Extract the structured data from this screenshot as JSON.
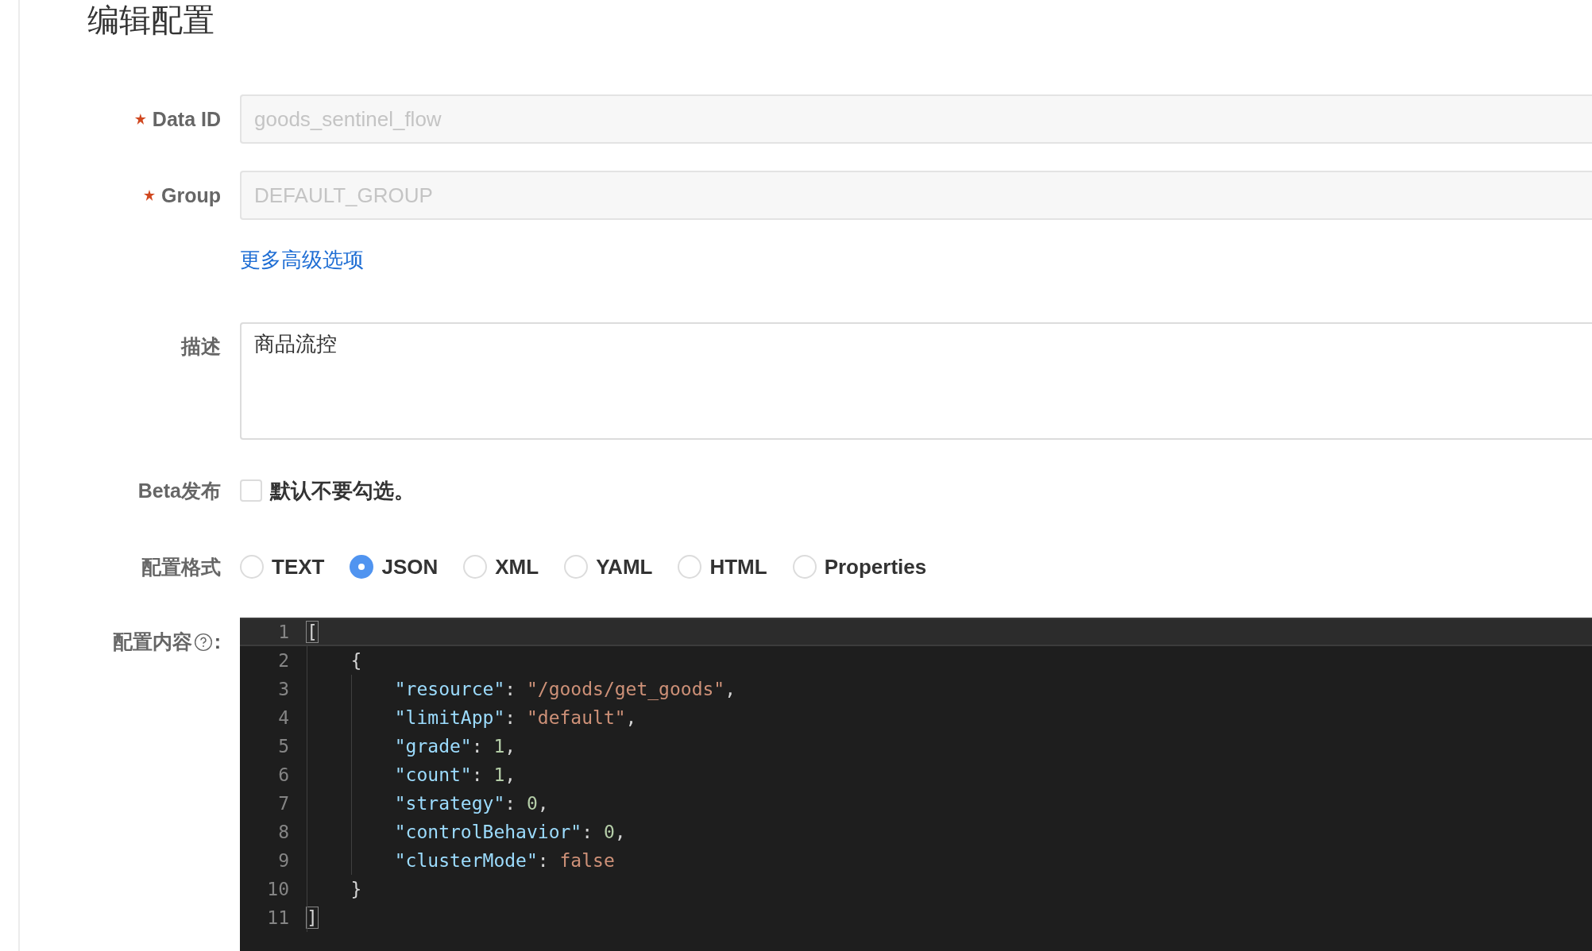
{
  "title": "编辑配置",
  "fields": [
    {
      "label": "Data ID",
      "required": true,
      "placeholder": "goods_sentinel_flow"
    },
    {
      "label": "Group",
      "required": true,
      "placeholder": "DEFAULT_GROUP"
    }
  ],
  "advanced_link": "更多高级选项",
  "description": {
    "label": "描述",
    "value": "商品流控"
  },
  "beta": {
    "label": "Beta发布",
    "checked": false,
    "text": "默认不要勾选。"
  },
  "format": {
    "label": "配置格式",
    "options": [
      {
        "label": "TEXT",
        "selected": false
      },
      {
        "label": "JSON",
        "selected": true
      },
      {
        "label": "XML",
        "selected": false
      },
      {
        "label": "YAML",
        "selected": false
      },
      {
        "label": "HTML",
        "selected": false
      },
      {
        "label": "Properties",
        "selected": false
      }
    ]
  },
  "content": {
    "label": "配置内容",
    "colon": ":",
    "lines": [
      {
        "number": "1",
        "active": true,
        "tokens": [
          {
            "kind": "match",
            "text": "["
          }
        ]
      },
      {
        "number": "2",
        "active": false,
        "tokens": [
          {
            "kind": "punct",
            "text": "    {"
          }
        ]
      },
      {
        "number": "3",
        "active": false,
        "tokens": [
          {
            "kind": "key",
            "text": "        \"resource\""
          },
          {
            "kind": "punct",
            "text": ": "
          },
          {
            "kind": "string",
            "text": "\"/goods/get_goods\""
          },
          {
            "kind": "punct",
            "text": ","
          }
        ]
      },
      {
        "number": "4",
        "active": false,
        "tokens": [
          {
            "kind": "key",
            "text": "        \"limitApp\""
          },
          {
            "kind": "punct",
            "text": ": "
          },
          {
            "kind": "string",
            "text": "\"default\""
          },
          {
            "kind": "punct",
            "text": ","
          }
        ]
      },
      {
        "number": "5",
        "active": false,
        "tokens": [
          {
            "kind": "key",
            "text": "        \"grade\""
          },
          {
            "kind": "punct",
            "text": ": "
          },
          {
            "kind": "number",
            "text": "1"
          },
          {
            "kind": "punct",
            "text": ","
          }
        ]
      },
      {
        "number": "6",
        "active": false,
        "tokens": [
          {
            "kind": "key",
            "text": "        \"count\""
          },
          {
            "kind": "punct",
            "text": ": "
          },
          {
            "kind": "number",
            "text": "1"
          },
          {
            "kind": "punct",
            "text": ","
          }
        ]
      },
      {
        "number": "7",
        "active": false,
        "tokens": [
          {
            "kind": "key",
            "text": "        \"strategy\""
          },
          {
            "kind": "punct",
            "text": ": "
          },
          {
            "kind": "number",
            "text": "0"
          },
          {
            "kind": "punct",
            "text": ","
          }
        ]
      },
      {
        "number": "8",
        "active": false,
        "tokens": [
          {
            "kind": "key",
            "text": "        \"controlBehavior\""
          },
          {
            "kind": "punct",
            "text": ": "
          },
          {
            "kind": "number",
            "text": "0"
          },
          {
            "kind": "punct",
            "text": ","
          }
        ]
      },
      {
        "number": "9",
        "active": false,
        "tokens": [
          {
            "kind": "key",
            "text": "        \"clusterMode\""
          },
          {
            "kind": "punct",
            "text": ": "
          },
          {
            "kind": "keyword",
            "text": "false"
          }
        ]
      },
      {
        "number": "10",
        "active": false,
        "tokens": [
          {
            "kind": "punct",
            "text": "    }"
          }
        ]
      },
      {
        "number": "11",
        "active": false,
        "tokens": [
          {
            "kind": "match",
            "text": "]"
          }
        ]
      }
    ]
  }
}
